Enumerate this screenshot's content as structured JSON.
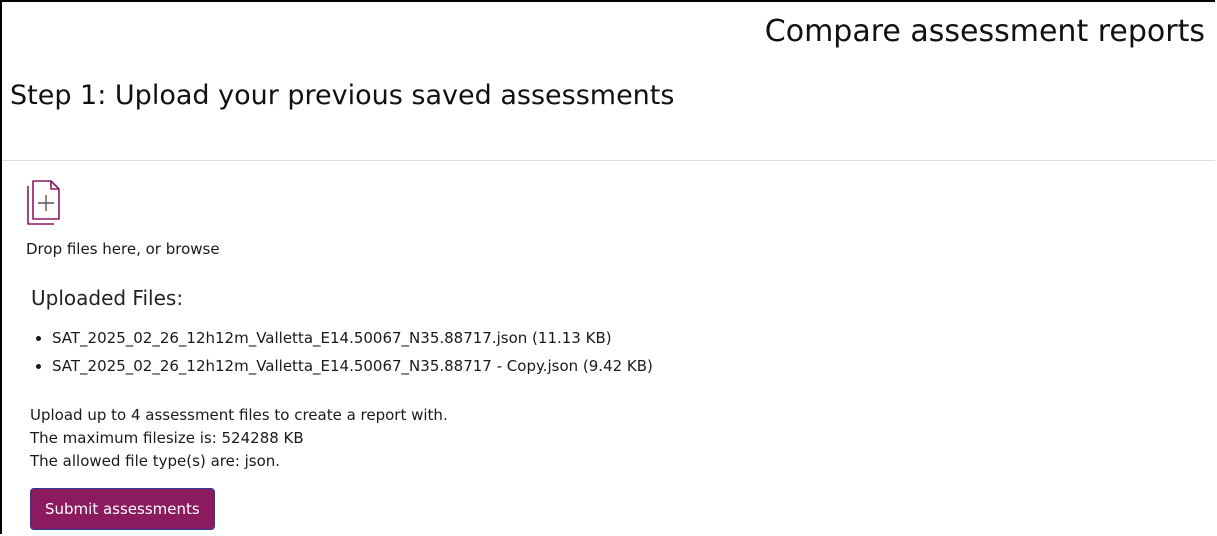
{
  "page": {
    "title": "Compare assessment reports"
  },
  "step": {
    "heading": "Step 1: Upload your previous saved assessments"
  },
  "dropzone": {
    "icon": "file-add-icon",
    "text_prefix": "Drop files here, or ",
    "browse_label": "browse",
    "accent_color": "#8b1a5f"
  },
  "uploaded": {
    "heading": "Uploaded Files:",
    "files": [
      {
        "label": "SAT_2025_02_26_12h12m_Valletta_E14.50067_N35.88717.json (11.13 KB)"
      },
      {
        "label": "SAT_2025_02_26_12h12m_Valletta_E14.50067_N35.88717 - Copy.json (9.42 KB)"
      }
    ]
  },
  "info": {
    "limit_text": "Upload up to 4 assessment files to create a report with.",
    "max_size_text": "The maximum filesize is: 524288 KB",
    "allowed_types_text": "The allowed file type(s) are: json."
  },
  "actions": {
    "submit_label": "Submit assessments",
    "submit_color": "#8b1a5f",
    "submit_border_color": "#2a3a9a"
  }
}
